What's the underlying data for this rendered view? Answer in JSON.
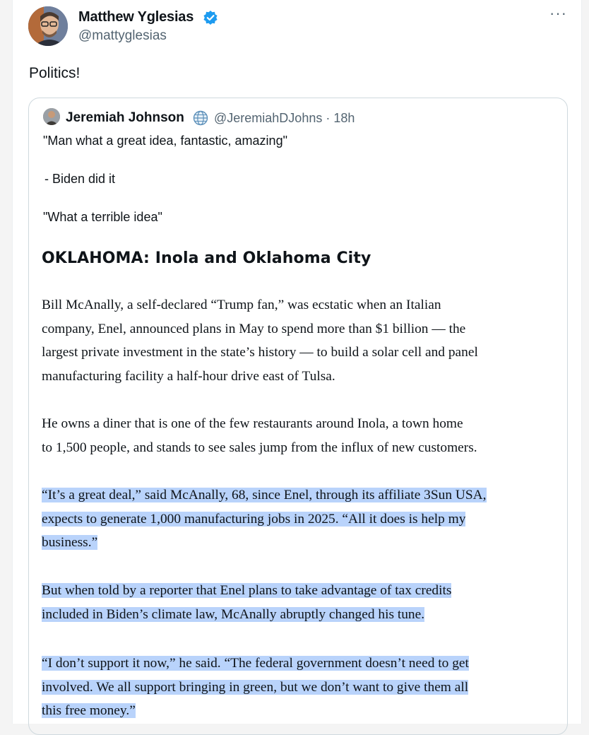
{
  "tweet": {
    "author_name": "Matthew Yglesias",
    "author_handle": "@mattyglesias",
    "more_label": "···",
    "text": "Politics!"
  },
  "quoted": {
    "author_name": "Jeremiah Johnson",
    "handle_time": "@JeremiahDJohns · 18h",
    "line1": "\"Man what a great idea, fantastic, amazing\"",
    "line2": "- Biden did it",
    "line3": "\"What a terrible idea\"",
    "article": {
      "heading": "OKLAHOMA: Inola and Oklahoma City",
      "p1": [
        "Bill McAnally, a self-declared “Trump fan,” was ecstatic when an Italian",
        "company, Enel, announced plans in May to spend more than $1 billion — the",
        "largest private investment in the state’s history — to build a solar cell and panel",
        "manufacturing facility a half-hour drive east of Tulsa."
      ],
      "p2": [
        "He owns a diner that is one of the few restaurants around Inola, a town home",
        "to 1,500 people, and stands to see sales jump from the influx of new customers."
      ],
      "p3": [
        "“It’s a great deal,” said McAnally, 68, since Enel, through its affiliate 3Sun USA,",
        "expects to generate 1,000 manufacturing jobs in 2025. “All it does is help my",
        "business.”"
      ],
      "p4": [
        "But when told by a reporter that Enel plans to take advantage of tax credits",
        "included in Biden’s climate law, McAnally abruptly changed his tune."
      ],
      "p5": [
        "“I don’t support it now,” he said. “The federal government doesn’t need to get",
        "involved. We all support bringing in green, but we don’t want to give them all",
        "this free money.”"
      ]
    }
  },
  "colors": {
    "verified": "#1d9bf0",
    "highlight": "#b9d3fb",
    "muted_text": "#536471"
  }
}
